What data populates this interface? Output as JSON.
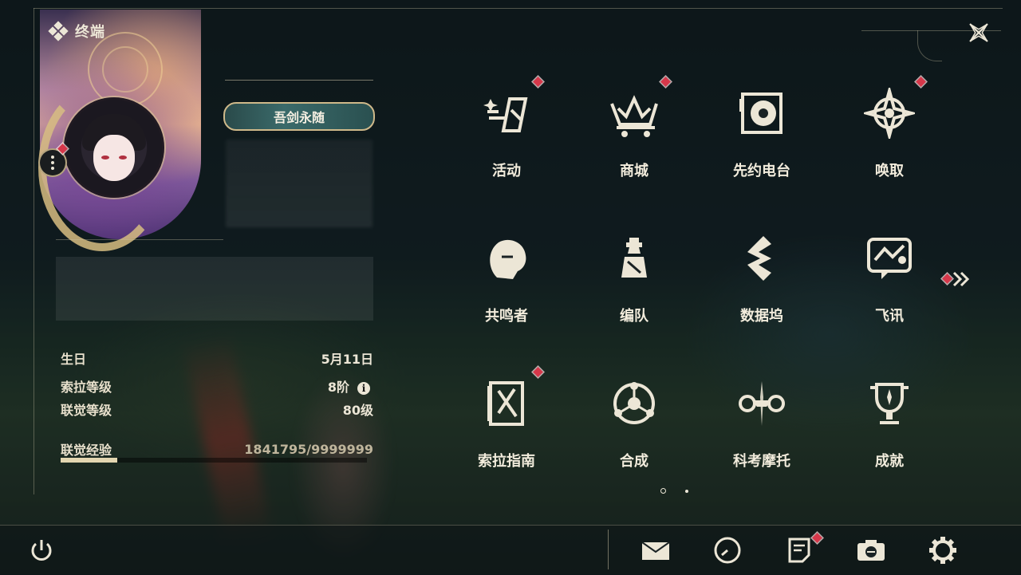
{
  "header": {
    "title": "终端"
  },
  "profile": {
    "title_badge": "吾剑永随",
    "stats": [
      {
        "label": "生日",
        "value": "5月11日"
      },
      {
        "label": "索拉等级",
        "value": "8阶"
      },
      {
        "label": "联觉等级",
        "value": "80级"
      },
      {
        "label": "联觉经验",
        "value": "1841795/9999999"
      }
    ],
    "exp_progress": 0.184
  },
  "menu": {
    "items": [
      {
        "label": "活动",
        "icon": "activity-icon",
        "badge": true
      },
      {
        "label": "商城",
        "icon": "shop-crown-icon",
        "badge": true
      },
      {
        "label": "先约电台",
        "icon": "radio-record-icon",
        "badge": false
      },
      {
        "label": "唤取",
        "icon": "convene-star-icon",
        "badge": true
      },
      {
        "label": "共鸣者",
        "icon": "resonator-head-icon",
        "badge": false
      },
      {
        "label": "编队",
        "icon": "team-chess-icon",
        "badge": false
      },
      {
        "label": "数据坞",
        "icon": "data-bank-icon",
        "badge": false
      },
      {
        "label": "飞讯",
        "icon": "message-chat-icon",
        "badge": false
      },
      {
        "label": "索拉指南",
        "icon": "guidebook-icon",
        "badge": true
      },
      {
        "label": "合成",
        "icon": "synthesis-icon",
        "badge": false
      },
      {
        "label": "科考摩托",
        "icon": "motorbike-icon",
        "badge": false
      },
      {
        "label": "成就",
        "icon": "trophy-icon",
        "badge": false
      }
    ],
    "page_count": 2,
    "current_page": 1
  },
  "bottom_bar": {
    "buttons": [
      "power-icon",
      "mail-icon",
      "clock-icon",
      "notes-icon",
      "camera-icon",
      "settings-gear-icon"
    ]
  },
  "colors": {
    "accent": "#e3d6b0",
    "badge_red": "#d6374a",
    "text": "#ece6d6"
  }
}
